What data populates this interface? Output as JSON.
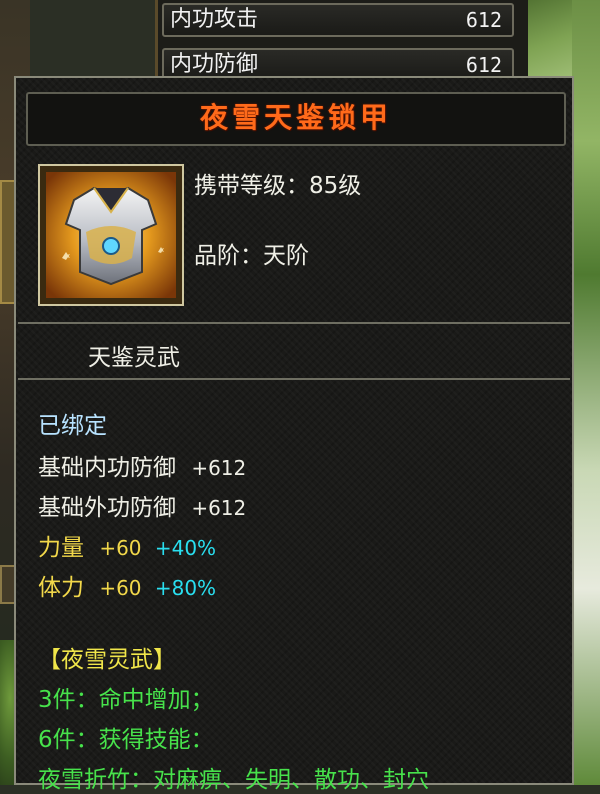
{
  "stats": [
    {
      "label": "内功攻击",
      "value": "612"
    },
    {
      "label": "内功防御",
      "value": "612"
    }
  ],
  "tooltip": {
    "item_name": "夜雪天鉴锁甲",
    "item_icon": "armor-chestplate-icon",
    "carry_level": "携带等级：85级",
    "grade": "品阶：天阶",
    "series": "天鉴灵武",
    "bound": "已绑定",
    "base_attrs": [
      {
        "name": "基础内功防御",
        "value": "+612"
      },
      {
        "name": "基础外功防御",
        "value": "+612"
      }
    ],
    "bonus_attrs": [
      {
        "name": "力量",
        "value": "+60",
        "percent": "+40%"
      },
      {
        "name": "体力",
        "value": "+60",
        "percent": "+80%"
      }
    ],
    "set_name": "【夜雪灵武】",
    "set_lines": [
      "3件：命中增加；",
      "6件：获得技能：",
      "夜雪折竹：对麻痹、失明、散功、封穴"
    ]
  },
  "colors": {
    "title": "#ff6a1a",
    "bound": "#b8e3ff",
    "bonus_label": "#f2d84a",
    "percent": "#29dff0",
    "set_text": "#47e24b",
    "set_name": "#f0e64a"
  }
}
